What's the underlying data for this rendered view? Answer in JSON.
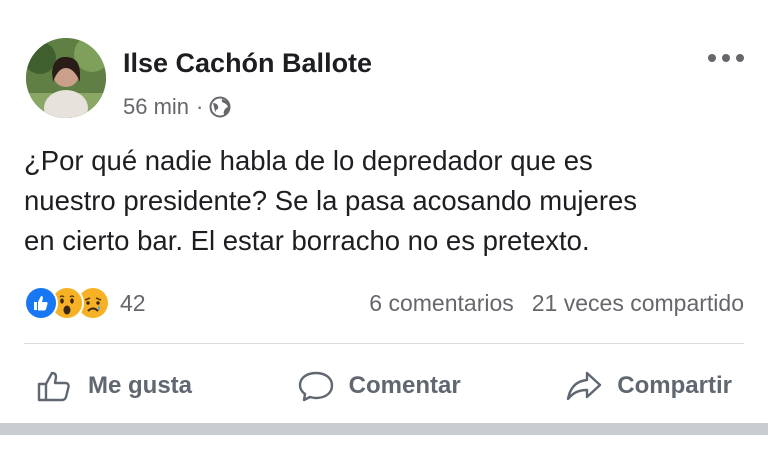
{
  "post": {
    "author": "Ilse Cachón Ballote",
    "time": "56 min",
    "separator": "·",
    "privacy_icon": "globe-icon",
    "more_icon": "more-options-icon",
    "text_lines": [
      "¿Por qué nadie habla de lo depredador que es",
      "nuestro presidente? Se la pasa acosando mujeres",
      "en cierto bar. El estar borracho no es pretexto."
    ]
  },
  "stats": {
    "reactions": [
      "like-reaction-icon",
      "wow-reaction-icon",
      "sad-reaction-icon"
    ],
    "reaction_count": "42",
    "comments": "6 comentarios",
    "shares": "21 veces compartido"
  },
  "actions": {
    "like_label": "Me gusta",
    "comment_label": "Comentar",
    "share_label": "Compartir"
  },
  "colors": {
    "text": "#1c1e21",
    "secondary": "#65676b",
    "like_blue": "#1877f2",
    "reaction_yellow": "#f7b125",
    "divider": "#dadde1"
  }
}
